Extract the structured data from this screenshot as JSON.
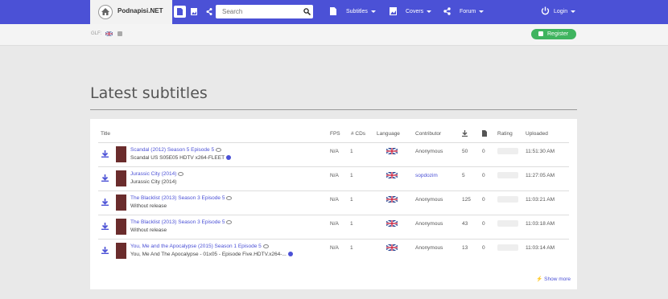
{
  "brand": {
    "name": "Podnapisi.NET"
  },
  "search": {
    "placeholder": "Search"
  },
  "nav": {
    "subtitles": "Subtitles",
    "covers": "Covers",
    "forum": "Forum",
    "login": "Login"
  },
  "subbar": {
    "glf_label": "GLF:",
    "register_label": "Register"
  },
  "page": {
    "title": "Latest subtitles"
  },
  "table": {
    "headers": [
      "Title",
      "FPS",
      "# CDs",
      "Language",
      "Contributor",
      "Rating",
      "Uploaded"
    ],
    "rows": [
      {
        "title": "Scandal (2012) Season 5 Episode 5",
        "release": "Scandal US S05E05 HDTV x264-FLEET",
        "fps": "N/A",
        "cds": "1",
        "contributor": "Anonymous",
        "downloads": "50",
        "comments": "0",
        "uploaded": "11:51:30 AM",
        "contributor_link": false,
        "has_plus": true
      },
      {
        "title": "Jurassic City (2014)",
        "release": "Jurassic City (2014)",
        "fps": "N/A",
        "cds": "1",
        "contributor": "sopdozim",
        "downloads": "5",
        "comments": "0",
        "uploaded": "11:27:05 AM",
        "contributor_link": true,
        "has_plus": false
      },
      {
        "title": "The Blacklist (2013) Season 3 Episode 5",
        "release": "Without release",
        "fps": "N/A",
        "cds": "1",
        "contributor": "Anonymous",
        "downloads": "125",
        "comments": "0",
        "uploaded": "11:03:21 AM",
        "contributor_link": false,
        "has_plus": false
      },
      {
        "title": "The Blacklist (2013) Season 3 Episode 5",
        "release": "Without release",
        "fps": "N/A",
        "cds": "1",
        "contributor": "Anonymous",
        "downloads": "43",
        "comments": "0",
        "uploaded": "11:03:18 AM",
        "contributor_link": false,
        "has_plus": false
      },
      {
        "title": "You, Me and the Apocalypse (2015) Season 1 Episode 5",
        "release": "You, Me And The Apocalypse - 01x05 - Episode Five.HDTV.x264-...",
        "fps": "N/A",
        "cds": "1",
        "contributor": "Anonymous",
        "downloads": "13",
        "comments": "0",
        "uploaded": "11:03:14 AM",
        "contributor_link": false,
        "has_plus": true
      }
    ],
    "show_more": "Show more"
  },
  "icons": {
    "home": "home-icon",
    "download": "download-icon",
    "file": "file-icon",
    "image": "image-icon",
    "share": "share-icon",
    "search": "search-icon",
    "power": "power-icon",
    "flag": "uk-flag-icon",
    "eye": "eye-icon"
  },
  "colors": {
    "accent": "#4b51d6",
    "register": "#3fb45f"
  }
}
